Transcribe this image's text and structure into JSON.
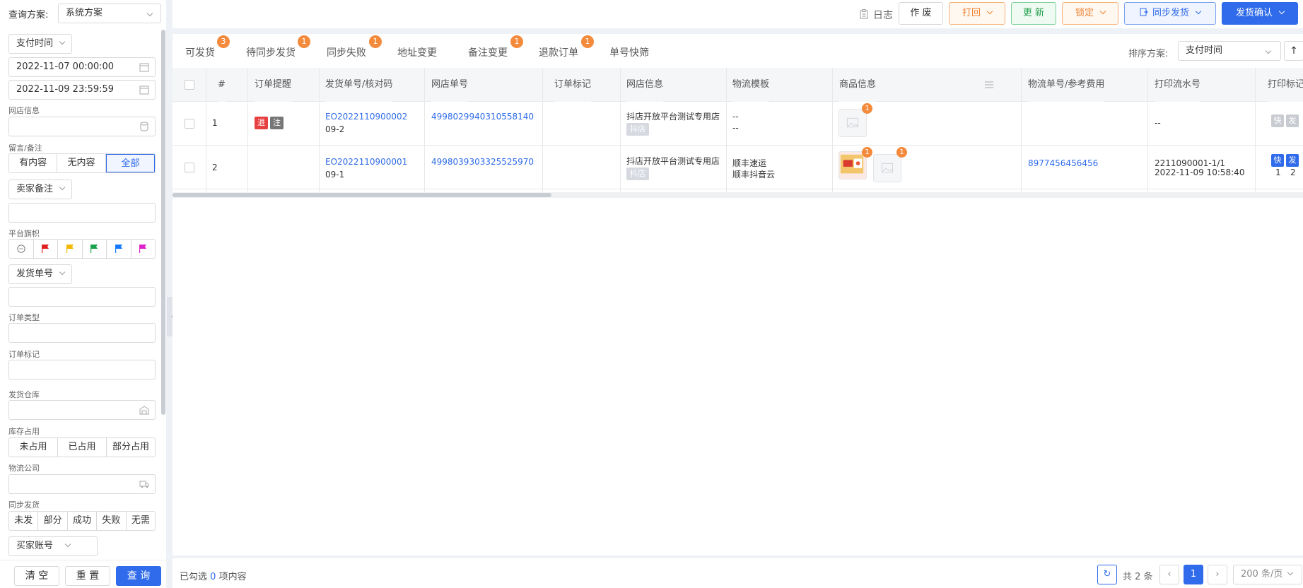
{
  "sidebar": {
    "scheme_label": "查询方案:",
    "scheme_value": "系统方案",
    "pay_time_label": "支付时间",
    "date_from": "2022-11-07 00:00:00",
    "date_to": "2022-11-09 23:59:59",
    "shop_label": "网店信息",
    "message_label": "留言/备注",
    "message_options": [
      "有内容",
      "无内容",
      "全部"
    ],
    "seller_note_label": "卖家备注",
    "flag_label": "平台旗帜",
    "flag_colors": [
      "#e02020",
      "#f5b800",
      "#1aa34a",
      "#1677ff",
      "#e020c8"
    ],
    "ship_no_label": "发货单号",
    "order_type_label": "订单类型",
    "order_mark_label": "订单标记",
    "warehouse_label": "发货仓库",
    "stock_label": "库存占用",
    "stock_options": [
      "未占用",
      "已占用",
      "部分占用"
    ],
    "logistics_label": "物流公司",
    "sync_label": "同步发货",
    "sync_options": [
      "未发",
      "部分",
      "成功",
      "失败",
      "无需"
    ],
    "buyer_label": "买家账号",
    "clear_btn": "清 空",
    "reset_btn": "重 置",
    "query_btn": "查 询"
  },
  "toolbar": {
    "log": "日志",
    "void": "作 废",
    "return": "打回",
    "update": "更 新",
    "lock": "锁定",
    "sync_ship": "同步发货",
    "confirm_ship": "发货确认"
  },
  "tabs": [
    {
      "label": "可发货",
      "badge": "3"
    },
    {
      "label": "待同步发货",
      "badge": "1"
    },
    {
      "label": "同步失败",
      "badge": "1"
    },
    {
      "label": "地址变更",
      "badge": ""
    },
    {
      "label": "备注变更",
      "badge": "1"
    },
    {
      "label": "退款订单",
      "badge": "1"
    },
    {
      "label": "单号快筛",
      "badge": ""
    }
  ],
  "sort": {
    "label": "排序方案:",
    "value": "支付时间"
  },
  "table": {
    "headers": [
      "#",
      "订单提醒",
      "发货单号/核对码",
      "网店单号",
      "订单标记",
      "网店信息",
      "物流模板",
      "商品信息",
      "物流单号/参考费用",
      "打印流水号",
      "打印标记"
    ],
    "rows": [
      {
        "index": "1",
        "tag1": "退",
        "tag2": "注",
        "ship_no": "EO2022110900002",
        "check_code": "09-2",
        "shop_order": "4998029940310558140",
        "shop_name": "抖店开放平台测试专用店",
        "shop_tag": "抖店",
        "logistics_1": "--",
        "logistics_2": "--",
        "goods_badge": "1",
        "tracking": "",
        "print_serial": "--",
        "print_time": "",
        "mark1": "快",
        "mark2": "发",
        "count1": "",
        "count2": ""
      },
      {
        "index": "2",
        "tag1": "",
        "tag2": "",
        "ship_no": "EO2022110900001",
        "check_code": "09-1",
        "shop_order": "4998039303325525970",
        "shop_name": "抖店开放平台测试专用店",
        "shop_tag": "抖店",
        "logistics_1": "顺丰速运",
        "logistics_2": "顺丰抖音云",
        "goods_badge": "1",
        "goods_badge2": "1",
        "tracking": "8977456456456",
        "print_serial": "2211090001-1/1",
        "print_time": "2022-11-09 10:58:40",
        "mark1": "快",
        "mark2": "发",
        "count1": "1",
        "count2": "2"
      }
    ]
  },
  "footer": {
    "selected_prefix": "已勾选",
    "selected_count": "0",
    "selected_suffix": "项内容",
    "total": "共 2 条",
    "page": "1",
    "page_size": "200 条/页"
  }
}
